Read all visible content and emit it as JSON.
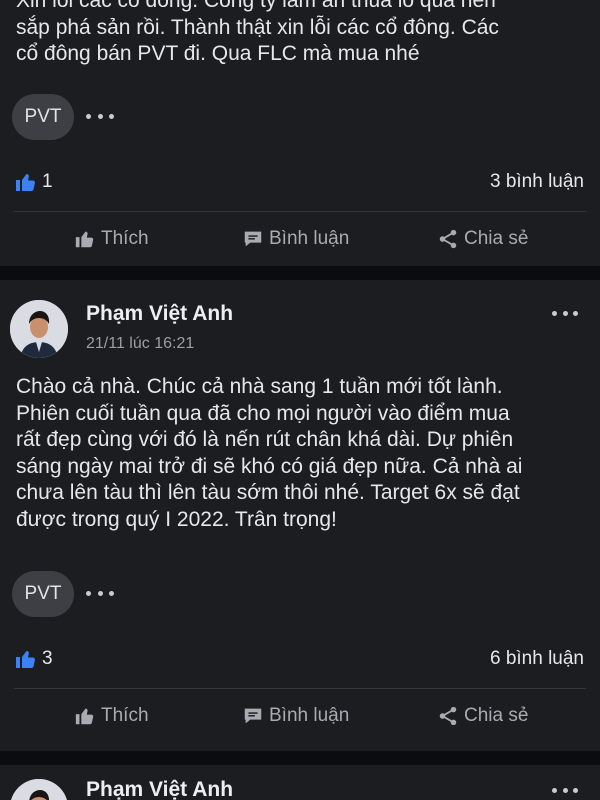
{
  "posts": [
    {
      "text_lines": [
        "Xin lỗi các cổ đông. Công ty làm ăn thua lỗ quá nên",
        "sắp phá sản rồi. Thành thật xin lỗi các cổ đông. Các",
        "cổ đông bán PVT đi. Qua FLC mà mua nhé"
      ],
      "tag": "PVT",
      "likes": "1",
      "comments": "3 bình luận"
    },
    {
      "author": "Phạm Việt Anh",
      "time": "21/11 lúc 16:21",
      "text_lines": [
        "Chào cả nhà. Chúc cả nhà sang 1 tuần mới tốt lành.",
        "Phiên cuối tuần qua đã cho mọi người vào điểm mua",
        "rất đẹp cùng với đó là nến rút chân khá dài. Dự phiên",
        "sáng ngày mai trở đi sẽ khó có giá đẹp nữa. Cả nhà ai",
        "chưa lên tàu thì lên tàu sớm thôi nhé. Target 6x sẽ đạt",
        "được trong quý I 2022. Trân trọng!"
      ],
      "tag": "PVT",
      "likes": "3",
      "comments": "6 bình luận"
    },
    {
      "author": "Phạm Việt Anh"
    }
  ],
  "actions": {
    "like": "Thích",
    "comment": "Bình luận",
    "share": "Chia sẻ"
  },
  "icons": {
    "like": "thumbs-up-icon",
    "comment": "speech-bubble-icon",
    "share": "share-icon",
    "more": "more-dots-icon"
  },
  "colors": {
    "like_blue": "#3b82f6",
    "background": "#1c1d20"
  }
}
